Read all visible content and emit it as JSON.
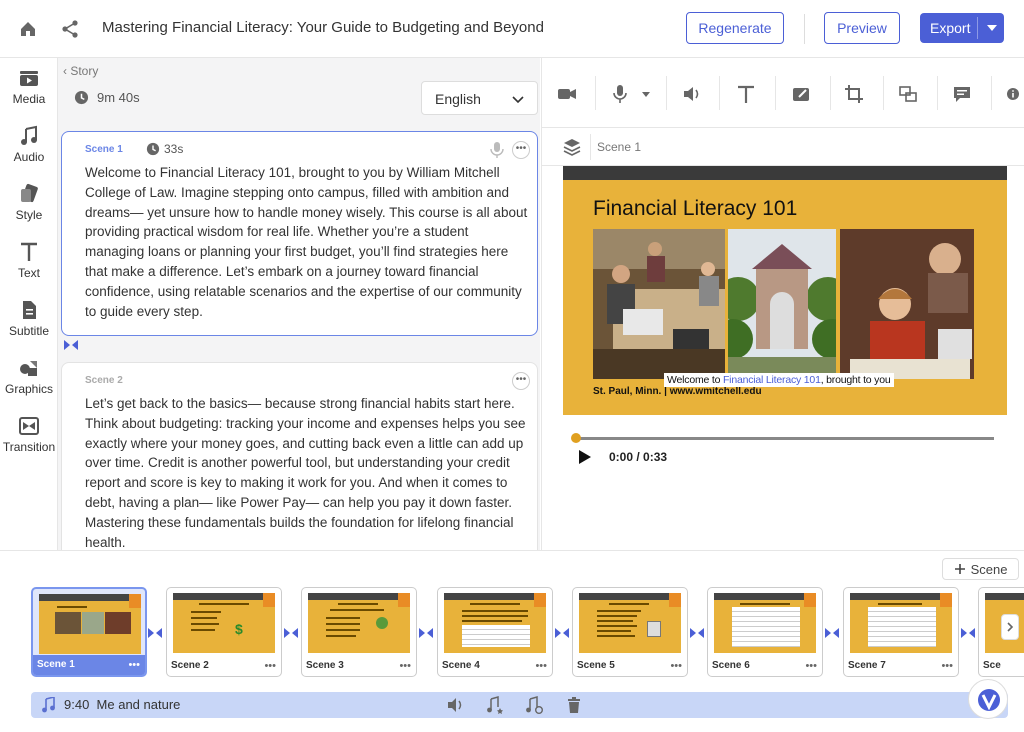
{
  "header": {
    "title": "Mastering Financial Literacy: Your Guide to Budgeting and Beyond",
    "regenerate_label": "Regenerate",
    "preview_label": "Preview",
    "export_label": "Export"
  },
  "rail": {
    "items": [
      {
        "label": "Media",
        "icon": "media-icon"
      },
      {
        "label": "Audio",
        "icon": "music-note-icon"
      },
      {
        "label": "Style",
        "icon": "style-icon"
      },
      {
        "label": "Text",
        "icon": "text-icon"
      },
      {
        "label": "Subtitle",
        "icon": "subtitle-icon"
      },
      {
        "label": "Graphics",
        "icon": "graphics-icon"
      },
      {
        "label": "Transition",
        "icon": "transition-icon"
      }
    ]
  },
  "story": {
    "breadcrumb": "Story",
    "total_duration": "9m 40s",
    "language": "English",
    "scenes": [
      {
        "label": "Scene 1",
        "duration": "33s",
        "text": "Welcome to Financial Literacy 101, brought to you by William Mitchell College of Law. Imagine stepping onto campus, filled with ambition and dreams— yet unsure how to handle money wisely. This course is all about providing practical wisdom for real life. Whether you’re a student managing loans or planning your first budget, you’ll find strategies here that make a difference. Let’s embark on a journey toward financial confidence, using relatable scenarios and the expertise of our community to guide every step."
      },
      {
        "label": "Scene 2",
        "text": "Let’s get back to the basics— because strong financial habits start here. Think about budgeting: tracking your income and expenses helps you see exactly where your money goes, and cutting back even a little can add up over time. Credit is another powerful tool, but understanding your credit report and score is key to making it work for you. And when it comes to debt, having a plan— like Power Pay— can help you pay it down faster. Mastering these fundamentals builds the foundation for lifelong financial health."
      }
    ]
  },
  "editor": {
    "layer_label": "Scene 1",
    "slide": {
      "title": "Financial Literacy 101",
      "footer": "St. Paul, Minn.  |  www.wmitchell.edu"
    },
    "caption": {
      "before": "Welcome to ",
      "highlight": "Financial Literacy 101",
      "after": ", brought to you"
    },
    "playback": {
      "time": "0:00 / 0:33",
      "progress": 0
    }
  },
  "timeline": {
    "add_scene_label": "Scene",
    "scenes": [
      {
        "name": "Scene 1",
        "active": true
      },
      {
        "name": "Scene 2"
      },
      {
        "name": "Scene 3"
      },
      {
        "name": "Scene 4"
      },
      {
        "name": "Scene 5"
      },
      {
        "name": "Scene 6"
      },
      {
        "name": "Scene 7"
      },
      {
        "name": "Sce"
      }
    ],
    "more_label": "•••",
    "audio": {
      "duration": "9:40",
      "title": "Me and nature"
    }
  },
  "colors": {
    "accent": "#4b5fd6",
    "scene_highlight": "#6b86e6",
    "slide_bg": "#e8b23a",
    "audio_track": "#c8d6f7"
  }
}
